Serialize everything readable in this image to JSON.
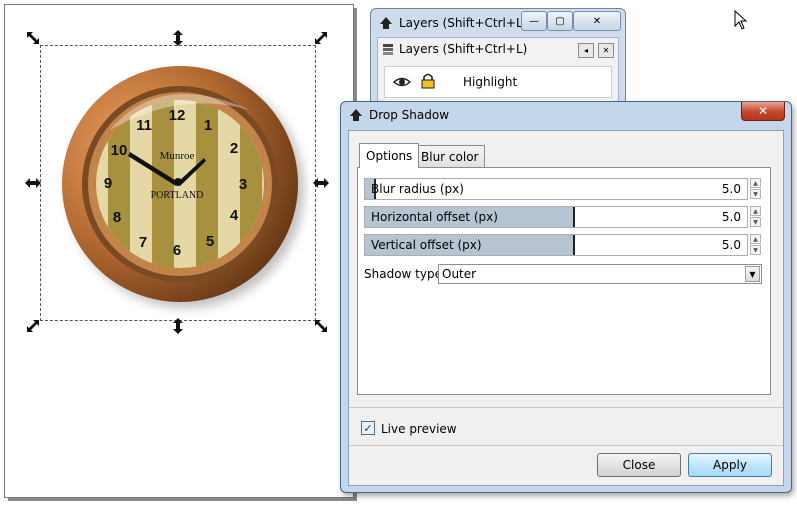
{
  "layers_window": {
    "title": "Layers (Shift+Ctrl+L)",
    "panel_title": "Layers (Shift+Ctrl+L)",
    "layer_name": "Highlight",
    "min_glyph": "—",
    "max_glyph": "▢",
    "close_glyph": "✕"
  },
  "clock": {
    "numbers": [
      "12",
      "1",
      "2",
      "3",
      "4",
      "5",
      "6",
      "7",
      "8",
      "9",
      "10",
      "11"
    ],
    "brand_top": "Munroe",
    "brand_bottom": "PORTLAND"
  },
  "dialog": {
    "title": "Drop Shadow",
    "close_glyph": "✕",
    "tabs": [
      {
        "label": "Options",
        "active": true
      },
      {
        "label": "Blur color",
        "active": false
      }
    ],
    "fields": [
      {
        "label": "Blur radius (px)",
        "value": "5.0",
        "fill_fraction": 0.03
      },
      {
        "label": "Horizontal offset (px)",
        "value": "5.0",
        "fill_fraction": 0.55
      },
      {
        "label": "Vertical offset (px)",
        "value": "5.0",
        "fill_fraction": 0.55
      }
    ],
    "shadow_type_label": "Shadow type:",
    "shadow_type_value": "Outer",
    "live_preview_label": "Live preview",
    "live_preview_checked": true,
    "check_glyph": "✓",
    "close_button": "Close",
    "apply_button": "Apply"
  },
  "colors": {
    "dialog_frame": "#c4d6ea",
    "close_red": "#c4462a",
    "clock_rim": "#a0602c",
    "clock_stripe_dark": "#a8913e",
    "clock_stripe_light": "#e6d8a6"
  }
}
